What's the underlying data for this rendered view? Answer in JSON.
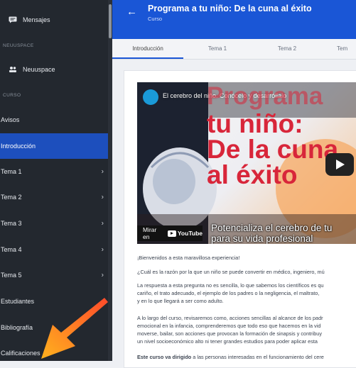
{
  "sidebar": {
    "mensajes": "Mensajes",
    "section_neuuspace": "NEUUSPACE",
    "neuuspace": "Neuuspace",
    "section_curso": "CURSO",
    "items": [
      {
        "label": "Avisos"
      },
      {
        "label": "Introducción"
      },
      {
        "label": "Tema 1"
      },
      {
        "label": "Tema 2"
      },
      {
        "label": "Tema 3"
      },
      {
        "label": "Tema 4"
      },
      {
        "label": "Tema 5"
      },
      {
        "label": "Estudiantes"
      },
      {
        "label": "Bibliografía"
      },
      {
        "label": "Calificaciones"
      }
    ]
  },
  "header": {
    "title": "Programa a tu niño: De la cuna al éxito",
    "subtitle": "Curso"
  },
  "tabs": [
    "Introducción",
    "Tema 1",
    "Tema 2",
    "Tem"
  ],
  "video": {
    "title": "El cerebro del niño. Conócelo y desarróllalo",
    "big_line1": "Programa",
    "big_line2": "tu niño:",
    "big_line3": "De la cuna",
    "big_line4": "al éxito",
    "watch_label": "Mirar en",
    "youtube": "YouTube",
    "footer_line1": "Potencializa el cerebro de tu",
    "footer_line2": "para su vida profesional"
  },
  "content": {
    "p1": "¡Bienvenidos a esta maravillosa experiencia!",
    "p2": "¿Cuál es la razón por la que un niño se puede convertir en médico, ingeniero, mú",
    "p3a": "La respuesta a esta pregunta no es sencilla, lo que sabemos los científicos es qu",
    "p3b": "cariño, el trato adecuado, el ejemplo de los padres o la negligencia, el maltrato,",
    "p3c": "y en lo que llegará a ser como adulto.",
    "p4a": "A lo largo del curso, revisaremos como, acciones sencillas al alcance de los padr",
    "p4b": "emocional en la infancia, comprenderemos que todo eso que hacemos en la vid",
    "p4c": "moverse, bailar, son acciones que provocan la formación de sinapsis y contribuy",
    "p4d": "un nivel socioeconómico alto ni tener grandes estudios para poder aplicar esta",
    "p5_bold": "Este curso va dirigido",
    "p5_rest": " a las personas interesadas en el funcionamiento del cere"
  },
  "colors": {
    "accent": "#1a56d6",
    "sidebar_bg": "#23282f",
    "arrow": "#f06a2a"
  }
}
